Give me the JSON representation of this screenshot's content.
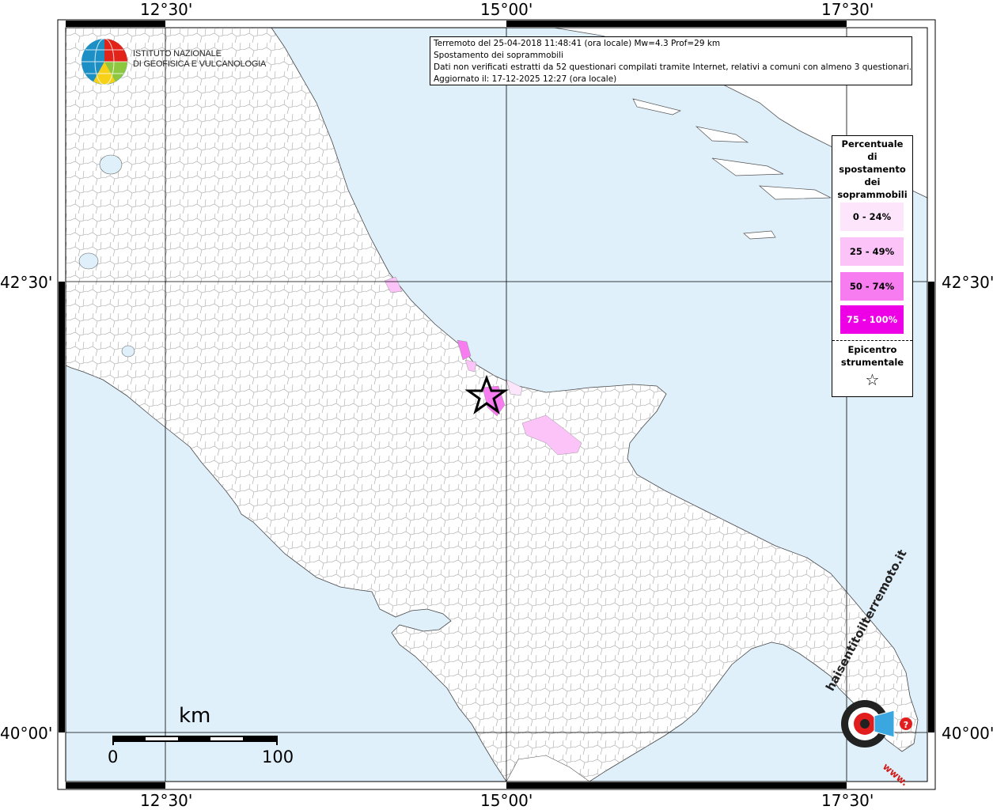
{
  "map": {
    "colors": {
      "sea": "#dff0fb",
      "land": "#ffffff",
      "boundary": "#9a9a9a",
      "frame": "#000000",
      "class_0_24": "#fde6fb",
      "class_25_49": "#fbc3f7",
      "class_50_74": "#f67cef",
      "class_75_100": "#ee00e6"
    },
    "lon_labels": {
      "west": "12°30'",
      "center": "15°00'",
      "east": "17°30'"
    },
    "lat_labels": {
      "north": "42°30'",
      "south": "40°00'"
    },
    "institute": {
      "line1": "ISTITUTO NAZIONALE",
      "line2": "DI GEOFISICA E VULCANOLOGIA",
      "logo_icon": "globe-logo-icon"
    },
    "info": {
      "line1": "Terremoto del 25-04-2018 11:48:41 (ora locale) Mw=4.3 Prof=29 km",
      "line2": "Spostamento dei soprammobili",
      "line3": "Dati non verificati estratti da 52 questionari compilati tramite Internet, relativi a comuni con almeno 3 questionari.",
      "line4": "Aggiornato il: 17-12-2025 12:27 (ora locale)"
    },
    "legend": {
      "title_lines": [
        "Percentuale",
        "di",
        "spostamento",
        "dei",
        "soprammobili"
      ],
      "classes": [
        "0 - 24%",
        "25 - 49%",
        "50 - 74%",
        "75 - 100%"
      ],
      "epicenter_lines": [
        "Epicentro",
        "strumentale"
      ],
      "epicenter_symbol": "☆"
    },
    "scale": {
      "unit": "km",
      "min": "0",
      "max": "100"
    },
    "website_logo": {
      "text": "haisentitoilterremoto.it",
      "prefix": "www.",
      "icon": "speaker-target-icon"
    }
  }
}
